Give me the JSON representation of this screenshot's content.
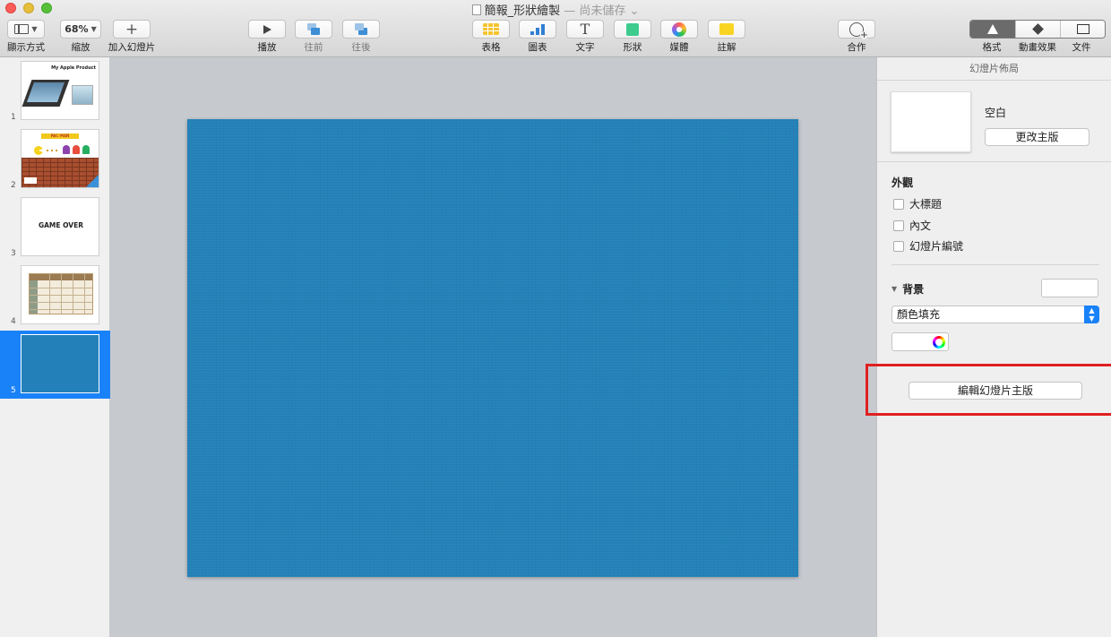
{
  "window": {
    "title": "簡報_形狀繪製",
    "subtitle": "— 尚未儲存 ⌄"
  },
  "toolbar": {
    "view_label": "顯示方式",
    "zoom_value": "68%",
    "zoom_label": "縮放",
    "add_slide_label": "加入幻燈片",
    "play_label": "播放",
    "forward_label": "往前",
    "backward_label": "往後",
    "table_label": "表格",
    "chart_label": "圖表",
    "text_label": "文字",
    "shape_label": "形狀",
    "media_label": "媒體",
    "comment_label": "註解",
    "collaborate_label": "合作",
    "format_label": "格式",
    "animate_label": "動畫效果",
    "document_label": "文件"
  },
  "navigator": {
    "slides": [
      {
        "number": "1",
        "title": "My Apple Product"
      },
      {
        "number": "2",
        "title": "PAC-MAN"
      },
      {
        "number": "3",
        "title": "GAME OVER"
      },
      {
        "number": "4"
      },
      {
        "number": "5",
        "selected": true
      }
    ]
  },
  "slide": {
    "background_color": "#2481b8"
  },
  "inspector": {
    "header": "幻燈片佈局",
    "layout_name": "空白",
    "change_master_label": "更改主版",
    "appearance": {
      "title": "外觀",
      "options": [
        {
          "label": "大標題",
          "checked": false
        },
        {
          "label": "內文",
          "checked": false
        },
        {
          "label": "幻燈片編號",
          "checked": false
        }
      ]
    },
    "background": {
      "title": "背景",
      "fill_type": "顏色填充"
    },
    "edit_master_label": "編輯幻燈片主版"
  },
  "colors": {
    "accent": "#1a82f8",
    "highlight": "#e02020",
    "slide_blue": "#2481b8"
  }
}
